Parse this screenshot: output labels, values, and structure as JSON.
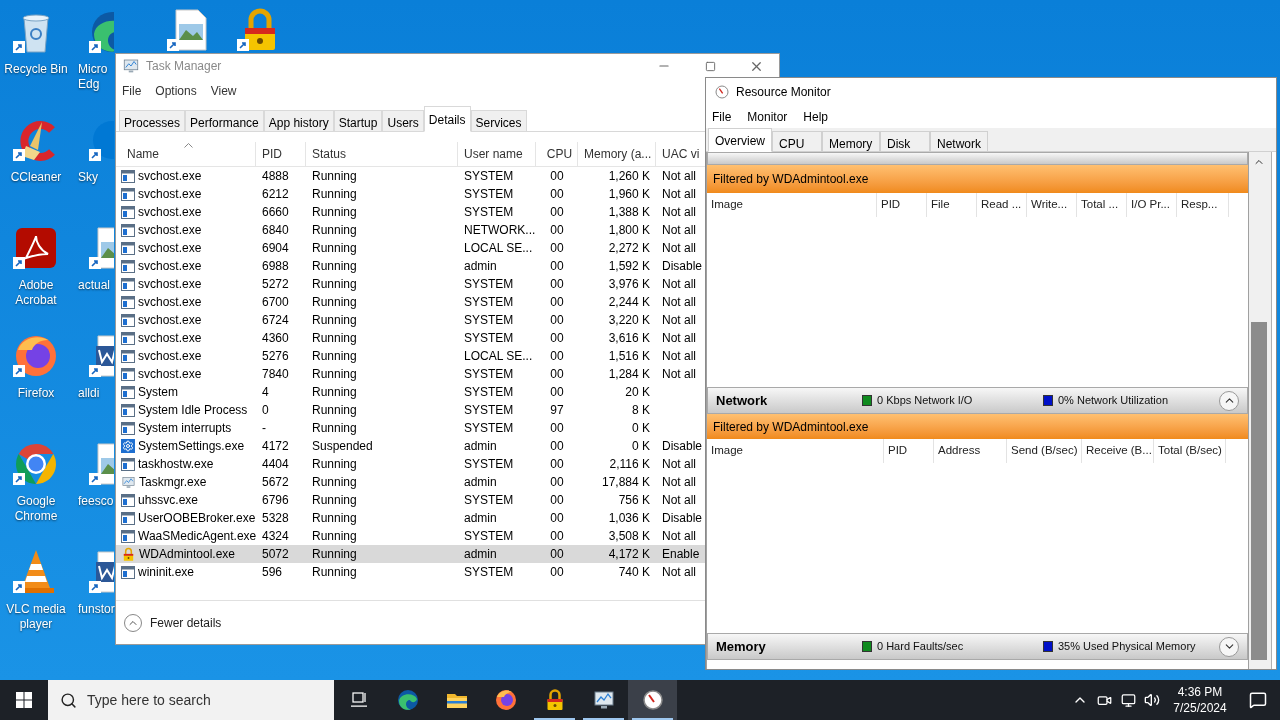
{
  "desktop": {
    "icons": [
      {
        "label": "Recycle Bin",
        "kind": "recycle"
      },
      {
        "label": "CCleaner",
        "kind": "ccleaner"
      },
      {
        "label": "Adobe Acrobat",
        "kind": "acrobat"
      },
      {
        "label": "Firefox",
        "kind": "firefox"
      },
      {
        "label": "Google Chrome",
        "kind": "chrome"
      },
      {
        "label": "VLC media player",
        "kind": "vlc"
      }
    ],
    "icons_2": [
      {
        "label": "Micro Edg",
        "kind": "edge"
      },
      {
        "label": "Sky",
        "kind": "skype"
      },
      {
        "label": "actual",
        "kind": "image"
      },
      {
        "label": "alldi",
        "kind": "word"
      },
      {
        "label": "feesco",
        "kind": "image"
      },
      {
        "label": "funstor",
        "kind": "word"
      }
    ],
    "top_icons": [
      {
        "kind": "image"
      },
      {
        "kind": "lock"
      }
    ]
  },
  "task_manager": {
    "title": "Task Manager",
    "menu": [
      "File",
      "Options",
      "View"
    ],
    "tabs": [
      {
        "label": "Processes",
        "selected": false
      },
      {
        "label": "Performance",
        "selected": false
      },
      {
        "label": "App history",
        "selected": false
      },
      {
        "label": "Startup",
        "selected": false
      },
      {
        "label": "Users",
        "selected": false
      },
      {
        "label": "Details",
        "selected": true
      },
      {
        "label": "Services",
        "selected": false
      }
    ],
    "columns": [
      "Name",
      "PID",
      "Status",
      "User name",
      "CPU",
      "Memory (a...",
      "UAC vi"
    ],
    "rows": [
      {
        "name": "svchost.exe",
        "pid": "4888",
        "status": "Running",
        "user": "SYSTEM",
        "cpu": "00",
        "memory": "1,260 K",
        "uac": "Not all",
        "kind": "window",
        "selected": false
      },
      {
        "name": "svchost.exe",
        "pid": "6212",
        "status": "Running",
        "user": "SYSTEM",
        "cpu": "00",
        "memory": "1,960 K",
        "uac": "Not all",
        "kind": "window",
        "selected": false
      },
      {
        "name": "svchost.exe",
        "pid": "6660",
        "status": "Running",
        "user": "SYSTEM",
        "cpu": "00",
        "memory": "1,388 K",
        "uac": "Not all",
        "kind": "window",
        "selected": false
      },
      {
        "name": "svchost.exe",
        "pid": "6840",
        "status": "Running",
        "user": "NETWORK...",
        "cpu": "00",
        "memory": "1,800 K",
        "uac": "Not all",
        "kind": "window",
        "selected": false
      },
      {
        "name": "svchost.exe",
        "pid": "6904",
        "status": "Running",
        "user": "LOCAL SE...",
        "cpu": "00",
        "memory": "2,272 K",
        "uac": "Not all",
        "kind": "window",
        "selected": false
      },
      {
        "name": "svchost.exe",
        "pid": "6988",
        "status": "Running",
        "user": "admin",
        "cpu": "00",
        "memory": "1,592 K",
        "uac": "Disable",
        "kind": "window",
        "selected": false
      },
      {
        "name": "svchost.exe",
        "pid": "5272",
        "status": "Running",
        "user": "SYSTEM",
        "cpu": "00",
        "memory": "3,976 K",
        "uac": "Not all",
        "kind": "window",
        "selected": false
      },
      {
        "name": "svchost.exe",
        "pid": "6700",
        "status": "Running",
        "user": "SYSTEM",
        "cpu": "00",
        "memory": "2,244 K",
        "uac": "Not all",
        "kind": "window",
        "selected": false
      },
      {
        "name": "svchost.exe",
        "pid": "6724",
        "status": "Running",
        "user": "SYSTEM",
        "cpu": "00",
        "memory": "3,220 K",
        "uac": "Not all",
        "kind": "window",
        "selected": false
      },
      {
        "name": "svchost.exe",
        "pid": "4360",
        "status": "Running",
        "user": "SYSTEM",
        "cpu": "00",
        "memory": "3,616 K",
        "uac": "Not all",
        "kind": "window",
        "selected": false
      },
      {
        "name": "svchost.exe",
        "pid": "5276",
        "status": "Running",
        "user": "LOCAL SE...",
        "cpu": "00",
        "memory": "1,516 K",
        "uac": "Not all",
        "kind": "window",
        "selected": false
      },
      {
        "name": "svchost.exe",
        "pid": "7840",
        "status": "Running",
        "user": "SYSTEM",
        "cpu": "00",
        "memory": "1,284 K",
        "uac": "Not all",
        "kind": "window",
        "selected": false
      },
      {
        "name": "System",
        "pid": "4",
        "status": "Running",
        "user": "SYSTEM",
        "cpu": "00",
        "memory": "20 K",
        "kind": "window",
        "selected": false
      },
      {
        "name": "System Idle Process",
        "pid": "0",
        "status": "Running",
        "user": "SYSTEM",
        "cpu": "97",
        "memory": "8 K",
        "kind": "window",
        "selected": false
      },
      {
        "name": "System interrupts",
        "pid": "-",
        "status": "Running",
        "user": "SYSTEM",
        "cpu": "00",
        "memory": "0 K",
        "kind": "window",
        "selected": false
      },
      {
        "name": "SystemSettings.exe",
        "pid": "4172",
        "status": "Suspended",
        "user": "admin",
        "cpu": "00",
        "memory": "0 K",
        "uac": "Disable",
        "kind": "gear",
        "selected": false
      },
      {
        "name": "taskhostw.exe",
        "pid": "4404",
        "status": "Running",
        "user": "SYSTEM",
        "cpu": "00",
        "memory": "2,116 K",
        "uac": "Not all",
        "kind": "window",
        "selected": false
      },
      {
        "name": "Taskmgr.exe",
        "pid": "5672",
        "status": "Running",
        "user": "admin",
        "cpu": "00",
        "memory": "17,884 K",
        "uac": "Not all",
        "kind": "monitor",
        "selected": false
      },
      {
        "name": "uhssvc.exe",
        "pid": "6796",
        "status": "Running",
        "user": "SYSTEM",
        "cpu": "00",
        "memory": "756 K",
        "uac": "Not all",
        "kind": "window",
        "selected": false
      },
      {
        "name": "UserOOBEBroker.exe",
        "pid": "5328",
        "status": "Running",
        "user": "admin",
        "cpu": "00",
        "memory": "1,036 K",
        "uac": "Disable",
        "kind": "window",
        "selected": false
      },
      {
        "name": "WaaSMedicAgent.exe",
        "pid": "4324",
        "status": "Running",
        "user": "SYSTEM",
        "cpu": "00",
        "memory": "3,508 K",
        "uac": "Not all",
        "kind": "window",
        "selected": false
      },
      {
        "name": "WDAdmintool.exe",
        "pid": "5072",
        "status": "Running",
        "user": "admin",
        "cpu": "00",
        "memory": "4,172 K",
        "uac": "Enable",
        "kind": "lock",
        "selected": true
      },
      {
        "name": "wininit.exe",
        "pid": "596",
        "status": "Running",
        "user": "SYSTEM",
        "cpu": "00",
        "memory": "740 K",
        "uac": "Not all",
        "kind": "window",
        "selected": false
      }
    ],
    "footer": "Fewer details"
  },
  "resource_monitor": {
    "title": "Resource Monitor",
    "menu": [
      "File",
      "Monitor",
      "Help"
    ],
    "tabs": [
      {
        "label": "Overview",
        "selected": true
      },
      {
        "label": "CPU",
        "selected": false
      },
      {
        "label": "Memory",
        "selected": false
      },
      {
        "label": "Disk",
        "selected": false
      },
      {
        "label": "Network",
        "selected": false
      }
    ],
    "sections": [
      {
        "expanded": true,
        "filter": "Filtered by WDAdmintool.exe",
        "columns": [
          "Image",
          "PID",
          "File",
          "Read ...",
          "Write...",
          "Total ...",
          "I/O Pr...",
          "Resp..."
        ]
      },
      {
        "title": "Network",
        "stats": [
          {
            "label": "0 Kbps Network I/O",
            "color": "#0f8a1e"
          },
          {
            "label": "0% Network Utilization",
            "color": "#0010c8"
          }
        ],
        "expanded": true,
        "filter": "Filtered by WDAdmintool.exe",
        "columns": [
          "Image",
          "PID",
          "Address",
          "Send (B/sec)",
          "Receive (B...",
          "Total (B/sec)"
        ]
      },
      {
        "title": "Memory",
        "stats": [
          {
            "label": "0 Hard Faults/sec",
            "color": "#0f8a1e"
          },
          {
            "label": "35% Used Physical Memory",
            "color": "#0010c8"
          }
        ],
        "expanded": false
      }
    ]
  },
  "taskbar": {
    "search": {
      "placeholder": "Type here to search"
    },
    "apps": [
      {
        "kind": "taskview",
        "running": false,
        "selected": false
      },
      {
        "kind": "edge",
        "running": false,
        "selected": false
      },
      {
        "kind": "folder",
        "running": false,
        "selected": false
      },
      {
        "kind": "firefox",
        "running": false,
        "selected": false
      },
      {
        "kind": "lock",
        "running": true,
        "selected": false
      },
      {
        "kind": "taskmgr",
        "running": true,
        "selected": false
      },
      {
        "kind": "resmon",
        "running": true,
        "selected": true
      }
    ],
    "time": "4:36 PM",
    "date": "7/25/2024"
  }
}
